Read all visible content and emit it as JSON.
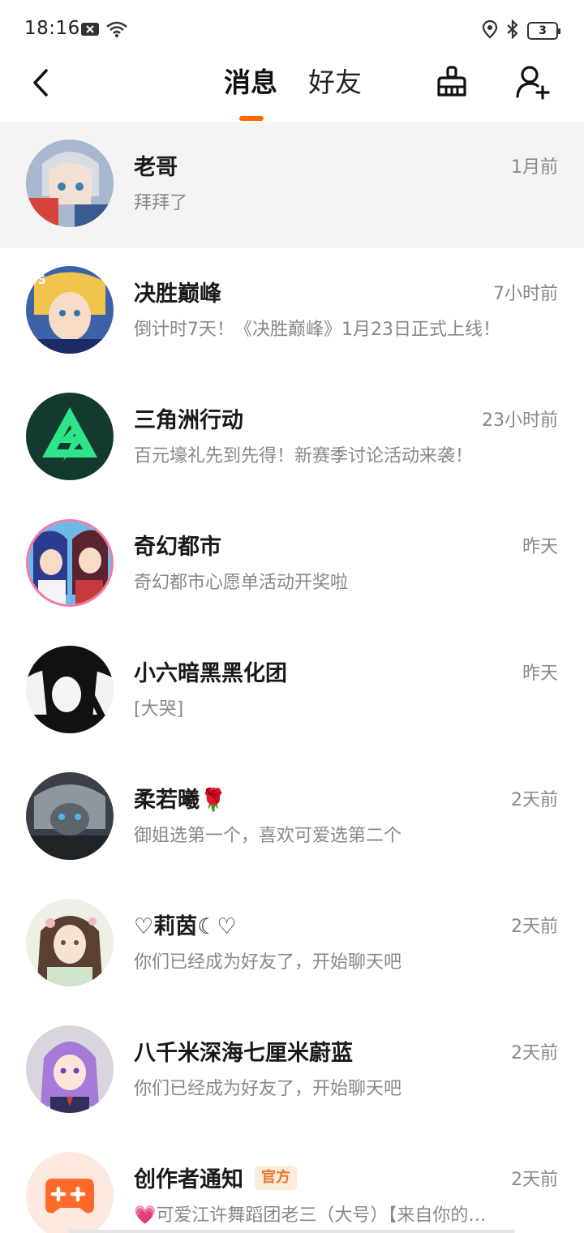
{
  "status_bar": {
    "time": "18:16",
    "battery": "3",
    "icons": [
      "x-notification-icon",
      "wifi-icon",
      "location-icon",
      "bluetooth-icon",
      "battery-icon"
    ]
  },
  "nav": {
    "tab_messages": "消息",
    "tab_friends": "好友",
    "accent_color": "#ff6a00"
  },
  "conversations": [
    {
      "name": "老哥",
      "time": "1月前",
      "preview": "拜拜了",
      "avatar_icon": "anime-avatar"
    },
    {
      "name": "决胜巅峰",
      "time": "7小时前",
      "preview": "倒计时7天！《决胜巅峰》1月23日正式上线！",
      "avatar_icon": "game-avatar"
    },
    {
      "name": "三角洲行动",
      "time": "23小时前",
      "preview": "百元壕礼先到先得！新赛季讨论活动来袭！",
      "avatar_icon": "delta-logo"
    },
    {
      "name": "奇幻都市",
      "time": "昨天",
      "preview": "奇幻都市心愿单活动开奖啦",
      "avatar_icon": "anime-avatar"
    },
    {
      "name": "小六暗黑黑化团",
      "time": "昨天",
      "preview": "[大哭]",
      "avatar_icon": "manga-avatar"
    },
    {
      "name": "柔若曦🌹",
      "time": "2天前",
      "preview": "御姐选第一个，喜欢可爱选第二个",
      "avatar_icon": "dark-avatar"
    },
    {
      "name": "♡莉茵☾♡",
      "time": "2天前",
      "preview": "你们已经成为好友了，开始聊天吧",
      "avatar_icon": "anime-avatar"
    },
    {
      "name": "八千米深海七厘米蔚蓝",
      "time": "2天前",
      "preview": "你们已经成为好友了，开始聊天吧",
      "avatar_icon": "anime-avatar"
    },
    {
      "name": "创作者通知",
      "badge": "官方",
      "time": "2天前",
      "preview": "💗可爱江许舞蹈团老三（大号）【来自你的…",
      "avatar_icon": "gamepad-plus-icon"
    }
  ]
}
